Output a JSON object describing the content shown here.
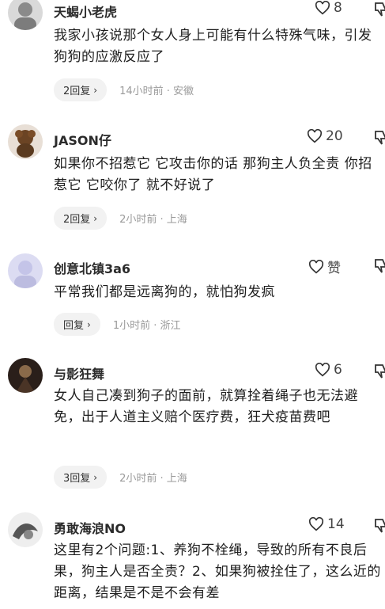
{
  "comments": [
    {
      "username": "天蝎小老虎",
      "likes": "8",
      "text": "我家小孩说那个女人身上可能有什么特殊气味，引发狗狗的应激反应了",
      "reply_label": "2回复",
      "meta": "14小时前 · 安徽"
    },
    {
      "username": "JASON仔",
      "likes": "20",
      "text": "如果你不招惹它 它攻击你的话 那狗主人负全责 你招惹它 它咬你了 就不好说了",
      "reply_label": "2回复",
      "meta": "2小时前 · 上海"
    },
    {
      "username": "创意北镇3a6",
      "likes": "赞",
      "text": "平常我们都是远离狗的，就怕狗发疯",
      "reply_label": "回复",
      "meta": "1小时前 · 浙江"
    },
    {
      "username": "与影狂舞",
      "likes": "6",
      "text": "女人自己凑到狗子的面前，就算拴着绳子也无法避免，出于人道主义赔个医疗费，狂犬疫苗费吧",
      "reply_label": "3回复",
      "meta": "2小时前 · 上海"
    },
    {
      "username": "勇敢海浪NO",
      "likes": "14",
      "text": "这里有2个问题:1、养狗不栓绳，导致的所有不良后果，狗主人是否全责？2、如果狗被拴住了，这么近的距离，结果是不是不会有差",
      "reply_label": "",
      "meta": ""
    }
  ],
  "icons": {
    "like": "heart-outline-icon",
    "dislike": "thumbs-down-icon",
    "reply_arrow": "chevron-right-icon"
  }
}
